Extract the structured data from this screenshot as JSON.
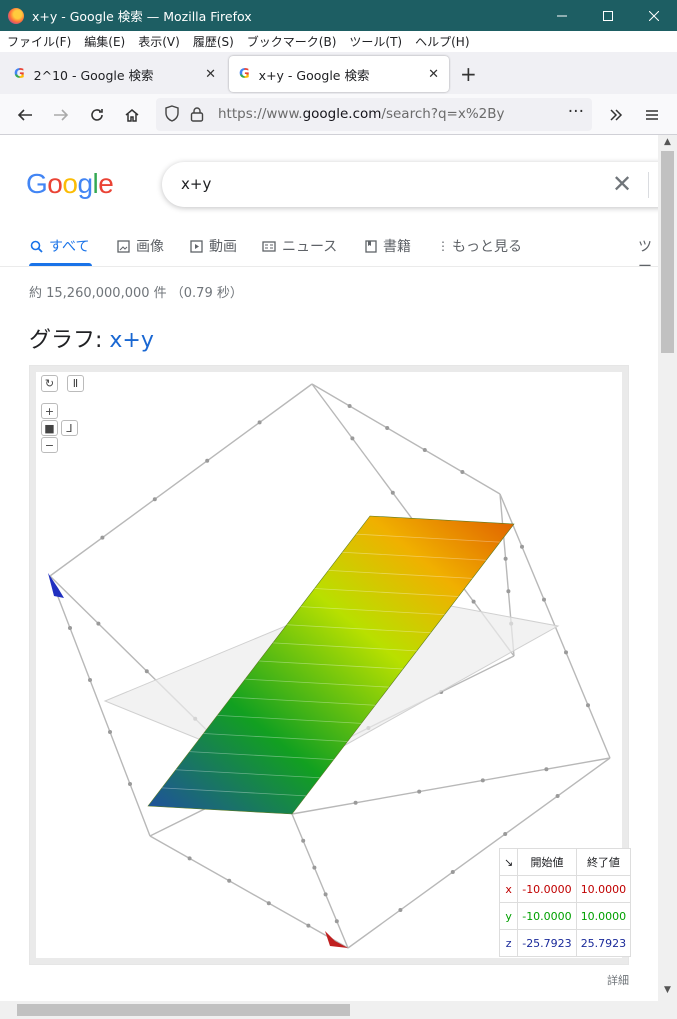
{
  "window": {
    "title": "x+y - Google 検索 — Mozilla Firefox",
    "minimize_icon": "minimize-icon",
    "maximize_icon": "maximize-icon",
    "close_icon": "close-icon"
  },
  "menu": [
    "ファイル(F)",
    "編集(E)",
    "表示(V)",
    "履歴(S)",
    "ブックマーク(B)",
    "ツール(T)",
    "ヘルプ(H)"
  ],
  "tabs": [
    {
      "title": "2^10 - Google 検索",
      "active": false
    },
    {
      "title": "x+y - Google 検索",
      "active": true
    }
  ],
  "nav": {
    "url_prefix": "https://www.",
    "url_domain": "google.com",
    "url_path": "/search?q=x%2By"
  },
  "google": {
    "logo": "Google",
    "query": "x+y",
    "search_tabs": [
      {
        "label": "すべて",
        "icon": "search-icon"
      },
      {
        "label": "画像",
        "icon": "image-icon"
      },
      {
        "label": "動画",
        "icon": "video-icon"
      },
      {
        "label": "ニュース",
        "icon": "news-icon"
      },
      {
        "label": "書籍",
        "icon": "book-icon"
      },
      {
        "label": "もっと見る",
        "icon": "more-icon"
      },
      {
        "label": "ツー"
      }
    ],
    "stats": "約 15,260,000,000 件 （0.79 秒）",
    "graph_title_prefix": "グラフ: ",
    "graph_title_expr": "x+y",
    "detail_link": "詳細"
  },
  "range_table": {
    "header_start": "開始値",
    "header_end": "終了値",
    "rows": [
      {
        "axis": "x",
        "start": "-10.0000",
        "end": "10.0000",
        "color": "#c00000"
      },
      {
        "axis": "y",
        "start": "-10.0000",
        "end": "10.0000",
        "color": "#00a000"
      },
      {
        "axis": "z",
        "start": "-25.7923",
        "end": "25.7923",
        "color": "#1a2a9a"
      }
    ]
  }
}
